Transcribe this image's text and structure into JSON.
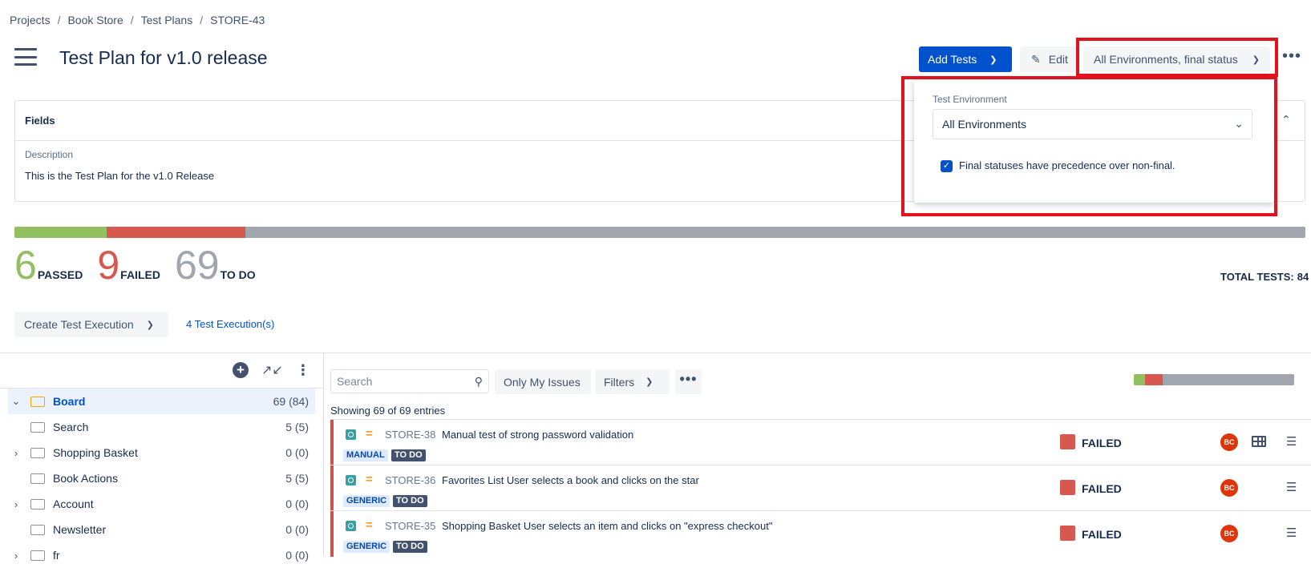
{
  "breadcrumb": [
    "Projects",
    "Book Store",
    "Test Plans",
    "STORE-43"
  ],
  "page_title": "Test Plan for v1.0 release",
  "header": {
    "add_tests_label": "Add Tests",
    "edit_label": "Edit",
    "environment_button_label": "All Environments, final status",
    "more_label": "•••"
  },
  "environment_panel": {
    "label": "Test Environment",
    "selected": "All Environments",
    "final_status_checked": true,
    "final_status_label": "Final statuses have precedence over non-final."
  },
  "fields": {
    "title": "Fields",
    "description_label": "Description",
    "description_value": "This is the Test Plan for the v1.0 Release"
  },
  "progress": {
    "passed": 6,
    "failed": 9,
    "todo": 69,
    "colors": {
      "passed": "#92bf60",
      "failed": "#d6584e",
      "todo": "#a1a5ad"
    }
  },
  "counts": {
    "passed_num": "6",
    "passed_label": "PASSED",
    "failed_num": "9",
    "failed_label": "FAILED",
    "todo_num": "69",
    "todo_label": "TO DO"
  },
  "total_tests": {
    "label": "TOTAL TESTS:",
    "value": "84"
  },
  "executions": {
    "create_label": "Create Test Execution",
    "link_label": "4 Test Execution(s)"
  },
  "tree": {
    "items": [
      {
        "name": "Board",
        "count": "69 (84)",
        "expand": "⌄",
        "selected": true
      },
      {
        "name": "Search",
        "count": "5 (5)",
        "expand": ""
      },
      {
        "name": "Shopping Basket",
        "count": "0 (0)",
        "expand": "›"
      },
      {
        "name": "Book Actions",
        "count": "5 (5)",
        "expand": ""
      },
      {
        "name": "Account",
        "count": "0 (0)",
        "expand": "›"
      },
      {
        "name": "Newsletter",
        "count": "0 (0)",
        "expand": ""
      },
      {
        "name": "fr",
        "count": "0 (0)",
        "expand": "›"
      }
    ]
  },
  "table": {
    "search_placeholder": "Search",
    "only_my_issues_label": "Only My Issues",
    "filters_label": "Filters",
    "more_label": "•••",
    "showing_text": "Showing 69 of 69 entries",
    "rows": [
      {
        "key": "STORE-38",
        "summary": "Manual test of strong password validation",
        "type": "MANUAL",
        "status_badge": "TO DO",
        "status": "FAILED",
        "avatar": "BC"
      },
      {
        "key": "STORE-36",
        "summary": "Favorites List User selects a book and clicks on the star",
        "type": "GENERIC",
        "status_badge": "TO DO",
        "status": "FAILED",
        "avatar": "BC"
      },
      {
        "key": "STORE-35",
        "summary": "Shopping Basket User selects an item and clicks on \"express checkout\"",
        "type": "GENERIC",
        "status_badge": "TO DO",
        "status": "FAILED",
        "avatar": "BC"
      }
    ]
  }
}
